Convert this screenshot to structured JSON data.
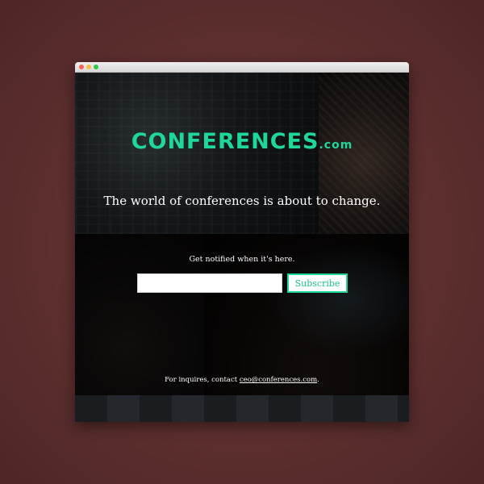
{
  "site": {
    "logo_main": "CONFERENCES",
    "logo_tld": ".com",
    "tagline": "The world of conferences is about to change.",
    "notify_text": "Get notified when it's here.",
    "email_placeholder": "",
    "subscribe_label": "Subscribe",
    "contact_prefix": "For inquires, contact ",
    "contact_email": "ceo@conferences.com",
    "contact_suffix": "."
  },
  "colors": {
    "accent": "#1ed89a",
    "background": "#5c2e2e"
  },
  "icons": [
    "close-dot",
    "minimize-dot",
    "zoom-dot"
  ]
}
